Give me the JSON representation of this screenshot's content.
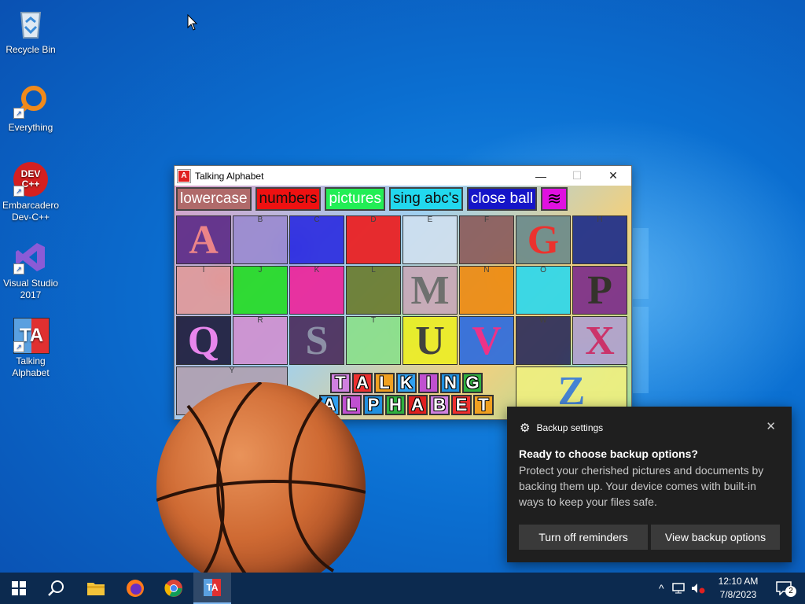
{
  "desktop": {
    "icons": [
      {
        "label": "Recycle Bin"
      },
      {
        "label": "Everything"
      },
      {
        "label": "Embarcadero Dev-C++"
      },
      {
        "label": "Visual Studio 2017"
      },
      {
        "label": "Talking Alphabet"
      }
    ],
    "devcpp_badge": "DEV C++",
    "talking_badge": "TA"
  },
  "window": {
    "title": "Talking Alphabet",
    "icon_letter": "A",
    "minimize_glyph": "—",
    "maximize_glyph": "☐",
    "close_glyph": "✕",
    "toolbar": {
      "lowercase": "lowercase",
      "numbers": "numbers",
      "pictures": "pictures",
      "sing": "sing abc's",
      "close_ball": "close ball",
      "wave_glyph": "≋"
    },
    "cells": [
      {
        "big": "A",
        "small": ""
      },
      {
        "big": "",
        "small": "B"
      },
      {
        "big": "",
        "small": "C"
      },
      {
        "big": "",
        "small": "D"
      },
      {
        "big": "",
        "small": "E"
      },
      {
        "big": "",
        "small": "F"
      },
      {
        "big": "G",
        "small": ""
      },
      {
        "big": "",
        "small": "H"
      },
      {
        "big": "",
        "small": "I"
      },
      {
        "big": "",
        "small": "J"
      },
      {
        "big": "",
        "small": "K"
      },
      {
        "big": "",
        "small": "L"
      },
      {
        "big": "M",
        "small": ""
      },
      {
        "big": "",
        "small": "N"
      },
      {
        "big": "",
        "small": "O"
      },
      {
        "big": "P",
        "small": ""
      },
      {
        "big": "Q",
        "small": ""
      },
      {
        "big": "",
        "small": "R"
      },
      {
        "big": "S",
        "small": ""
      },
      {
        "big": "",
        "small": "T"
      },
      {
        "big": "U",
        "small": ""
      },
      {
        "big": "V",
        "small": ""
      },
      {
        "big": "",
        "small": "W"
      },
      {
        "big": "X",
        "small": ""
      },
      {
        "big": "",
        "small": "Y"
      },
      {
        "big": "Z",
        "small": ""
      }
    ],
    "logo_row1": [
      "T",
      "A",
      "L",
      "K",
      "I",
      "N",
      "G"
    ],
    "logo_row2": [
      "A",
      "L",
      "P",
      "H",
      "A",
      "B",
      "E",
      "T"
    ]
  },
  "toast": {
    "header": "Backup settings",
    "title": "Ready to choose backup options?",
    "body": "Protect your cherished pictures and documents by backing them up. Your device comes with built-in ways to keep your files safe.",
    "btn_off": "Turn off reminders",
    "btn_view": "View backup options",
    "close_glyph": "✕",
    "gear_glyph": "⚙"
  },
  "taskbar": {
    "time": "12:10 AM",
    "date": "7/8/2023",
    "notification_count": "2",
    "chevron_glyph": "^"
  },
  "colors": {
    "taskbar": "#0c2a4f",
    "toast_bg": "#1f1f1f"
  }
}
